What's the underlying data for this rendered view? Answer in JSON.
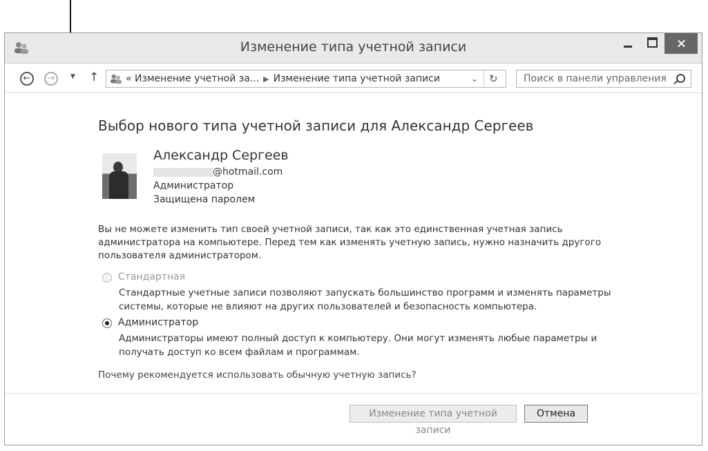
{
  "window": {
    "title": "Изменение типа учетной записи"
  },
  "navbar": {
    "back_icon": "back-arrow-icon",
    "forward_icon": "forward-arrow-icon",
    "up_icon": "up-arrow-icon",
    "breadcrumb_prefix": "«",
    "crumb1": "Изменение учетной за...",
    "crumb2": "Изменение типа учетной записи",
    "search_placeholder": "Поиск в панели управления"
  },
  "content": {
    "heading": "Выбор нового типа учетной записи для Александр Сергеев",
    "user": {
      "name": "Александр Сергеев",
      "email_suffix": "@hotmail.com",
      "role": "Администратор",
      "password_status": "Защищена паролем"
    },
    "note": "Вы не можете изменить тип своей учетной записи, так как это единственная учетная запись администратора на компьютере. Перед тем как изменять учетную запись, нужно назначить другого пользователя администратором.",
    "options": [
      {
        "label": "Стандартная",
        "description": "Стандартные учетные записи позволяют запускать большинство программ и изменять параметры системы, которые не влияют на других пользователей и безопасность компьютера.",
        "checked": false,
        "disabled": true
      },
      {
        "label": "Администратор",
        "description": "Администраторы имеют полный доступ к компьютеру. Они могут изменять любые параметры и получать доступ ко всем файлам и программам.",
        "checked": true,
        "disabled": false
      }
    ],
    "help_link": "Почему рекомендуется использовать обычную учетную запись?"
  },
  "buttons": {
    "change_type": "Изменение типа учетной записи",
    "cancel": "Отмена"
  }
}
